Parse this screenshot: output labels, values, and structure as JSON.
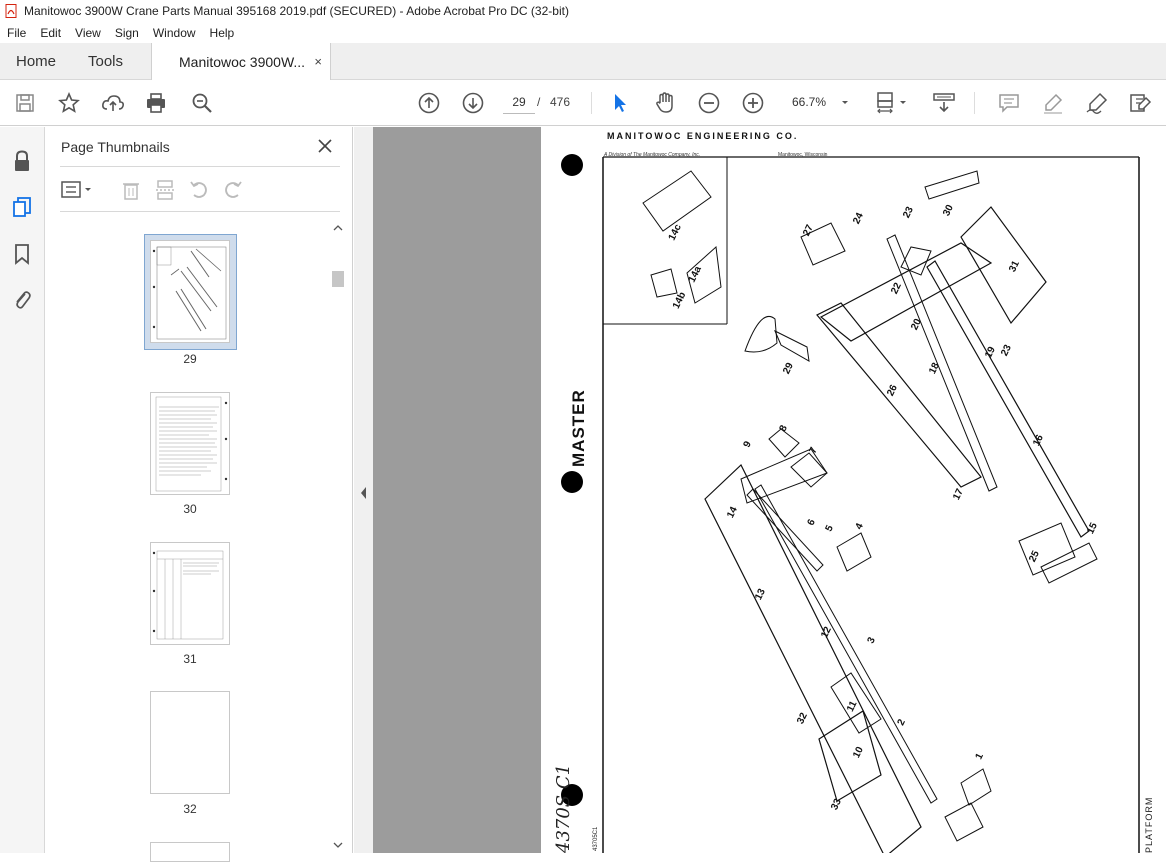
{
  "window": {
    "title": "Manitowoc 3900W Crane Parts Manual 395168 2019.pdf (SECURED) - Adobe Acrobat Pro DC (32-bit)"
  },
  "menu": [
    "File",
    "Edit",
    "View",
    "Sign",
    "Window",
    "Help"
  ],
  "tabs": {
    "home": "Home",
    "tools": "Tools",
    "document": "Manitowoc 3900W...",
    "close": "×"
  },
  "toolbar": {
    "page_current": "29",
    "page_separator": "/",
    "page_total": "476",
    "zoom": "66.7%"
  },
  "thumbnails": {
    "title": "Page Thumbnails",
    "close": "✕",
    "pages": [
      "29",
      "30",
      "31",
      "32"
    ],
    "selected": "29"
  },
  "document": {
    "header": "MANITOWOC ENGINEERING CO.",
    "sub_left": "A Division of The Manitowoc Company, Inc.",
    "sub_right": "Manitowoc, Wisconsin",
    "master": "MASTER",
    "handwritten_code": "4370S C1",
    "drawing_code": "43705C1",
    "platform_label": "PLATFORM",
    "callouts": [
      "14c",
      "14a",
      "14b",
      "27",
      "24",
      "23",
      "30",
      "31",
      "22",
      "20",
      "19",
      "23",
      "29",
      "18",
      "26",
      "16",
      "9",
      "8",
      "7",
      "14",
      "6",
      "5",
      "4",
      "17",
      "15",
      "25",
      "13",
      "12",
      "3",
      "32",
      "11",
      "2",
      "10",
      "1",
      "33"
    ]
  },
  "colors": {
    "accent_blue": "#1473e6",
    "doc_background": "#9c9c9c",
    "selection": "#cfdcec"
  }
}
